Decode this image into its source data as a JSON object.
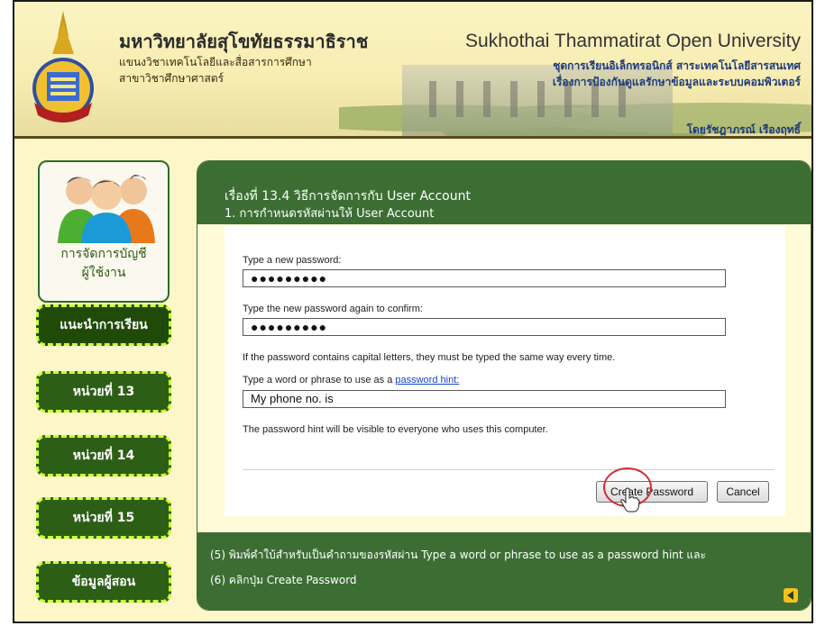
{
  "header": {
    "thai_title": "มหาวิทยาลัยสุโขทัยธรรมาธิราช",
    "thai_sub1": "แขนงวิชาเทคโนโลยีและสื่อสารการศึกษา",
    "thai_sub2": "สาขาวิชาศึกษาศาสตร์",
    "en_title": "Sukhothai Thammatirat Open University",
    "right_line1": "ชุดการเรียนอิเล็กทรอนิกส์ สาระเทคโนโลยีสารสนเทศ",
    "right_line2": "เรื่องการป้องกันดูแลรักษาข้อมูลและระบบคอมพิวเตอร์",
    "author": "โดยรัชฎาภรณ์ เรืองฤทธิ์"
  },
  "sidebar": {
    "card_label_line1": "การจัดการบัญชี",
    "card_label_line2": "ผู้ใช้งาน",
    "items": [
      {
        "label": "แนะนำการเรียน"
      },
      {
        "label": "หน่วยที่ 13"
      },
      {
        "label": "หน่วยที่ 14"
      },
      {
        "label": "หน่วยที่ 15"
      },
      {
        "label": "ข้อมูลผู้สอน"
      }
    ]
  },
  "lesson": {
    "title": "เรื่องที่ 13.4 วิธีการจัดการกับ User Account",
    "subtitle": "1. การกำหนดรหัสผ่านให้ User Account"
  },
  "dialog": {
    "new_password_label": "Type a new password:",
    "new_password_value": "●●●●●●●●●",
    "confirm_label": "Type the new password again to confirm:",
    "confirm_value": "●●●●●●●●●",
    "caps_note": "If the password contains capital letters, they must be typed the same way every time.",
    "hint_label_prefix": "Type a word or phrase to use as a ",
    "hint_link": "password hint:",
    "hint_value": "My phone no. is",
    "hint_note": "The password hint will be visible to everyone who uses this computer.",
    "create_button": "Create Password",
    "cancel_button": "Cancel"
  },
  "steps": {
    "step5": "(5) พิมพ์คำใบ้สำหรับเป็นคำถามของรหัสผ่าน Type a word or phrase to use as a password hint และ",
    "step6": "(6) คลิกปุ่ม Create Password"
  },
  "colors": {
    "dark_green": "#3c6e34",
    "nav_border": "#caff2f",
    "highlight": "#d23030"
  }
}
